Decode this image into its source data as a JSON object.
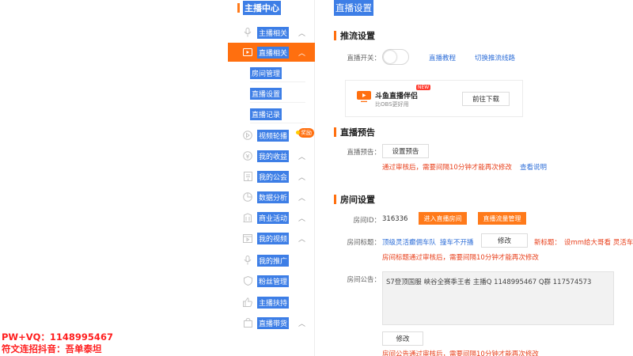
{
  "overlay": {
    "line1": "PW+VQ：1148995467",
    "line2": "符文连招抖音：吾单泰坦"
  },
  "sidebar": {
    "title": "主播中心",
    "items": [
      {
        "label": "主播相关",
        "icon": "mic-icon"
      },
      {
        "label": "直播相关",
        "icon": "video-icon",
        "active": true
      },
      {
        "label": "视频轮播",
        "icon": "carousel-icon"
      },
      {
        "label": "我的收益",
        "icon": "coin-icon"
      },
      {
        "label": "我的公会",
        "icon": "guild-icon"
      },
      {
        "label": "数据分析",
        "icon": "pie-chart-icon"
      },
      {
        "label": "商业活动",
        "icon": "building-icon"
      },
      {
        "label": "我的视频",
        "icon": "film-icon"
      },
      {
        "label": "我的推广",
        "icon": "promote-icon"
      },
      {
        "label": "粉丝管理",
        "icon": "shield-icon"
      },
      {
        "label": "主播扶持",
        "icon": "thumbs-up-icon"
      },
      {
        "label": "直播带货",
        "icon": "bag-icon"
      }
    ],
    "subitems": [
      "房间管理",
      "直播设置",
      "直播记录"
    ],
    "reward_badge": "奖励"
  },
  "main": {
    "page_title": "直播设置",
    "push": {
      "section_title": "推流设置",
      "switch_label": "直播开关：",
      "tutorial_link": "直播教程",
      "switch_line_link": "切换推流线路"
    },
    "promo": {
      "name": "斗鱼直播伴侣",
      "sub": "比OBS更好用",
      "new_badge": "NEW",
      "download_btn": "前往下载"
    },
    "preview": {
      "section_title": "直播预告",
      "label": "直播预告：",
      "set_btn": "设置预告",
      "warn": "通过审核后，需要间隔10分钟才能再次修改",
      "help_link": "查看说明"
    },
    "room": {
      "section_title": "房间设置",
      "id_label": "房间ID：",
      "id_value": "316336",
      "enter_btn": "进入直播房间",
      "manage_btn": "直播流量管理",
      "title_label": "房间标题：",
      "title_value": "顶级灵活癫佣车队",
      "title_value2": "撞车不开播",
      "edit_btn": "修改",
      "new_title_label": "新标题：",
      "new_title_value": "设mm给大哥看 灵活车",
      "title_warn": "房间标题通过审核后，需要间隔10分钟才能再次修改",
      "notice_label": "房间公告：",
      "notice_value": "S7登顶国服 峡谷全赛季王者 主播Q 1148995467 Q群 117574573",
      "notice_edit_btn": "修改",
      "notice_warn": "房间公告通过审核后，需要间隔10分钟才能再次修改"
    }
  },
  "colors": {
    "accent_orange": "#ff6f0f",
    "link_blue": "#2f6fd8",
    "warn_red": "#e8401c",
    "selection_blue": "#3d7ee6"
  }
}
